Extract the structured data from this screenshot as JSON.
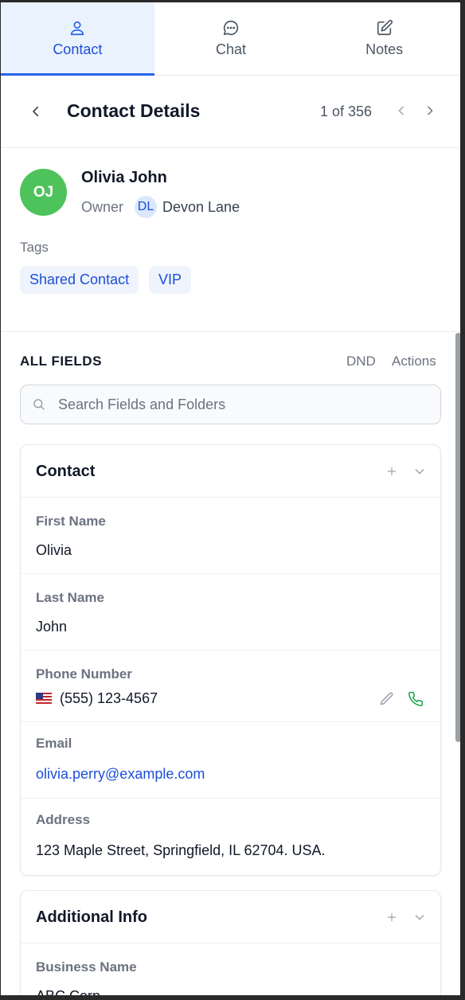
{
  "tabs": [
    {
      "label": "Contact",
      "icon": "user-icon"
    },
    {
      "label": "Chat",
      "icon": "chat-bubble-icon"
    },
    {
      "label": "Notes",
      "icon": "edit-icon"
    }
  ],
  "header": {
    "title": "Contact Details",
    "pager": "1 of 356"
  },
  "contact": {
    "initials": "OJ",
    "name": "Olivia John",
    "owner_label": "Owner",
    "owner_initials": "DL",
    "owner_name": "Devon Lane",
    "tags_label": "Tags",
    "tags": [
      "Shared Contact",
      "VIP"
    ]
  },
  "fields_section": {
    "title": "ALL FIELDS",
    "dnd_label": "DND",
    "actions_label": "Actions",
    "search_placeholder": "Search Fields and Folders"
  },
  "contact_card": {
    "title": "Contact",
    "fields": [
      {
        "label": "First Name",
        "value": "Olivia"
      },
      {
        "label": "Last Name",
        "value": "John"
      },
      {
        "label": "Phone Number",
        "value": "(555) 123-4567"
      },
      {
        "label": "Email",
        "value": "olivia.perry@example.com"
      },
      {
        "label": "Address",
        "value": "123 Maple Street, Springfield, IL 62704. USA."
      }
    ]
  },
  "additional_card": {
    "title": "Additional Info",
    "fields": [
      {
        "label": "Business Name",
        "value": "ABC Corp"
      }
    ]
  },
  "colors": {
    "accent": "#2563eb",
    "avatar_green": "#4ec35b",
    "tag_bg": "#eff4fc",
    "call_green": "#16a34a"
  }
}
